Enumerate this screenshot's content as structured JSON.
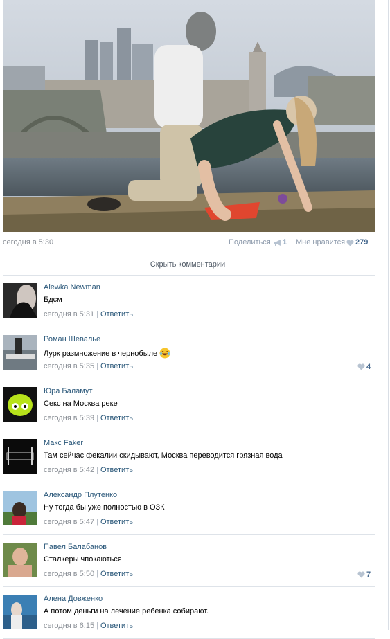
{
  "post": {
    "date": "сегодня в 5:30",
    "share_label": "Поделиться",
    "share_count": "1",
    "like_label": "Мне нравится",
    "like_count": "279"
  },
  "hide_comments_label": "Скрыть комментарии",
  "comments": [
    {
      "author": "Alewka Newman",
      "text": "Бдсм",
      "date": "сегодня в 5:31",
      "reply": "Ответить",
      "likes": ""
    },
    {
      "author": "Роман Шевалье",
      "text": "Лурк размножение в чернобыле",
      "date": "сегодня в 5:35",
      "reply": "Ответить",
      "likes": "4",
      "emoji": "laughing-tears-emoji"
    },
    {
      "author": "Юра Баламут",
      "text": "Секс на Москва реке",
      "date": "сегодня в 5:39",
      "reply": "Ответить",
      "likes": ""
    },
    {
      "author": "Макс Faker",
      "text": "Там сейчас фекалии скидывают, Москва переводится грязная вода",
      "date": "сегодня в 5:42",
      "reply": "Ответить",
      "likes": ""
    },
    {
      "author": "Александр Плутенко",
      "text": "Ну тогда бы уже полностью в ОЗК",
      "date": "сегодня в 5:47",
      "reply": "Ответить",
      "likes": ""
    },
    {
      "author": "Павел Балабанов",
      "text": "Сталкеры чпокаються",
      "date": "сегодня в 5:50",
      "reply": "Ответить",
      "likes": "7"
    },
    {
      "author": "Алена Довженко",
      "text": "А потом деньги на лечение ребенка собирают.",
      "date": "сегодня в 6:15",
      "reply": "Ответить",
      "likes": ""
    }
  ],
  "colors": {
    "link": "#2b587a",
    "meta": "#8a8f96",
    "count": "#45688e",
    "separator": "#dee3e9"
  }
}
